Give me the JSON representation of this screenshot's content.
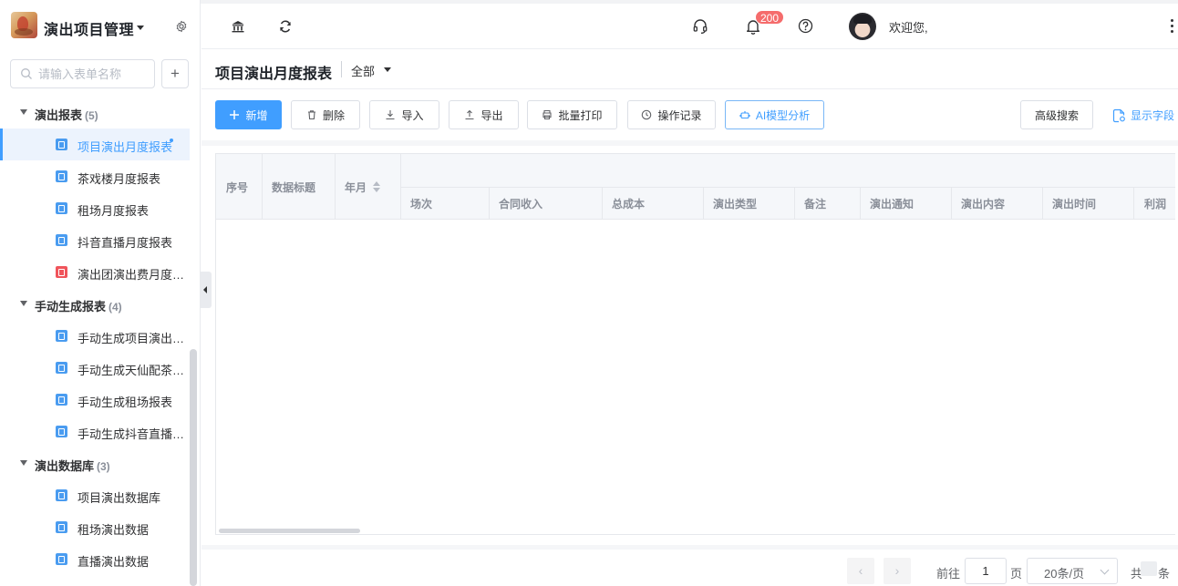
{
  "app": {
    "title": "演出项目管理"
  },
  "sidebar": {
    "search_placeholder": "请输入表单名称",
    "add_label": "+",
    "groups": [
      {
        "name": "演出报表",
        "count": "(5)",
        "items": [
          {
            "label": "项目演出月度报表",
            "icon": "form-icon",
            "active": true
          },
          {
            "label": "茶戏楼月度报表",
            "icon": "form-icon"
          },
          {
            "label": "租场月度报表",
            "icon": "form-icon"
          },
          {
            "label": "抖音直播月度报表",
            "icon": "form-icon"
          },
          {
            "label": "演出团演出费月度报表",
            "icon": "form-icon",
            "color": "#f0545b"
          }
        ]
      },
      {
        "name": "手动生成报表",
        "count": "(4)",
        "items": [
          {
            "label": "手动生成项目演出月度报表",
            "icon": "form-icon"
          },
          {
            "label": "手动生成天仙配茶戏楼报表",
            "icon": "form-icon"
          },
          {
            "label": "手动生成租场报表",
            "icon": "form-icon"
          },
          {
            "label": "手动生成抖音直播月度报表",
            "icon": "form-icon"
          }
        ]
      },
      {
        "name": "演出数据库",
        "count": "(3)",
        "items": [
          {
            "label": "项目演出数据库",
            "icon": "form-icon"
          },
          {
            "label": "租场演出数据",
            "icon": "form-icon"
          },
          {
            "label": "直播演出数据",
            "icon": "form-icon"
          }
        ]
      }
    ]
  },
  "header": {
    "notification_count": "200",
    "welcome": "欢迎您,"
  },
  "page": {
    "title": "项目演出月度报表",
    "scope": "全部"
  },
  "toolbar": {
    "add": "新增",
    "delete": "删除",
    "import": "导入",
    "export": "导出",
    "batch_print": "批量打印",
    "operation_log": "操作记录",
    "ai_analysis": "AI模型分析",
    "advanced_search": "高级搜索",
    "show_fields": "显示字段"
  },
  "table": {
    "fixed_columns": [
      "序号",
      "数据标题",
      "年月"
    ],
    "sub_columns": [
      "场次",
      "合同收入",
      "总成本",
      "演出类型",
      "备注",
      "演出通知",
      "演出内容",
      "演出时间",
      "利润"
    ],
    "rows": []
  },
  "pagination": {
    "goto_prefix": "前往",
    "page": "1",
    "page_suffix": "页",
    "page_size": "20条/页",
    "total_prefix": "共",
    "total_suffix": "条"
  },
  "colors": {
    "accent": "#409eff",
    "badge": "#f56c6c",
    "form_icon": "#4a9cf0",
    "form_icon_alert": "#f0545b"
  }
}
